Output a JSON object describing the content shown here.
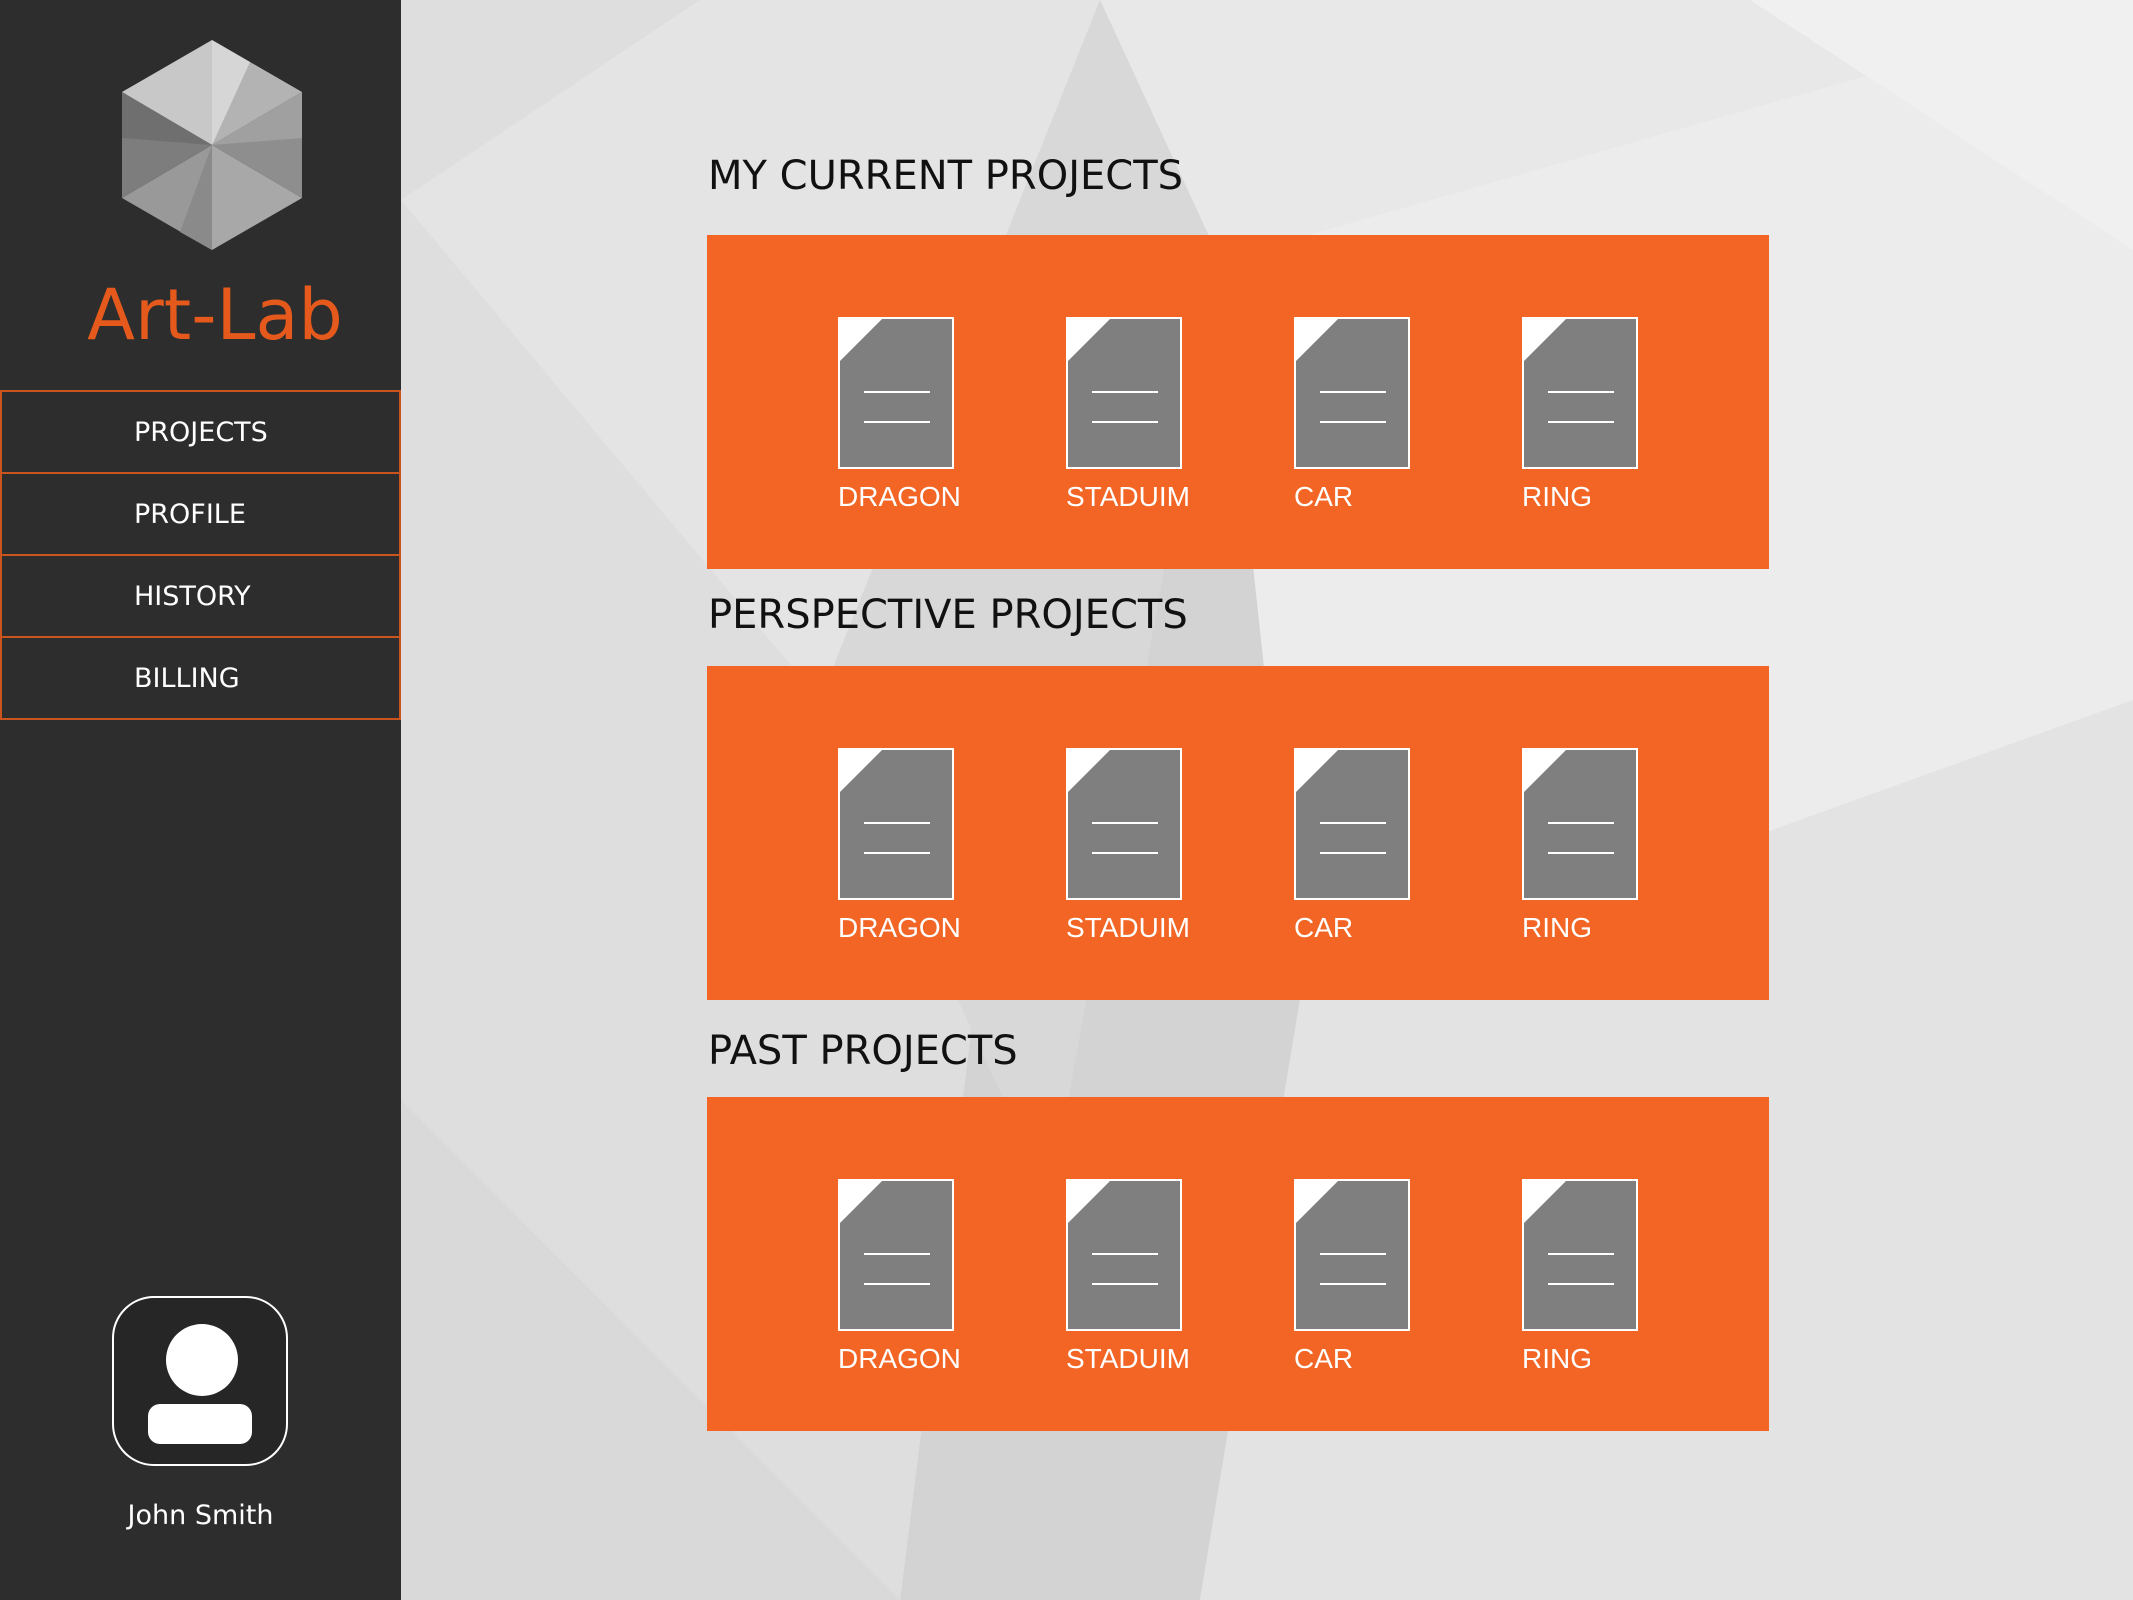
{
  "app": {
    "name": "Art-Lab",
    "accent_color": "#f26524",
    "sidebar_color": "#2d2d2d"
  },
  "logo": {
    "icon": "hexagon-aperture-icon"
  },
  "nav": {
    "items": [
      {
        "label": "PROJECTS"
      },
      {
        "label": "PROFILE"
      },
      {
        "label": "HISTORY"
      },
      {
        "label": "BILLING"
      }
    ]
  },
  "user": {
    "name": "John Smith",
    "icon": "user-avatar-icon"
  },
  "sections": [
    {
      "title": "MY CURRENT PROJECTS",
      "files": [
        {
          "label": "DRAGON",
          "icon": "file-icon"
        },
        {
          "label": "STADUIM",
          "icon": "file-icon"
        },
        {
          "label": "CAR",
          "icon": "file-icon"
        },
        {
          "label": "RING",
          "icon": "file-icon"
        }
      ]
    },
    {
      "title": "PERSPECTIVE PROJECTS",
      "files": [
        {
          "label": "DRAGON",
          "icon": "file-icon"
        },
        {
          "label": "STADUIM",
          "icon": "file-icon"
        },
        {
          "label": "CAR",
          "icon": "file-icon"
        },
        {
          "label": "RING",
          "icon": "file-icon"
        }
      ]
    },
    {
      "title": "PAST PROJECTS",
      "files": [
        {
          "label": "DRAGON",
          "icon": "file-icon"
        },
        {
          "label": "STADUIM",
          "icon": "file-icon"
        },
        {
          "label": "CAR",
          "icon": "file-icon"
        },
        {
          "label": "RING",
          "icon": "file-icon"
        }
      ]
    }
  ]
}
